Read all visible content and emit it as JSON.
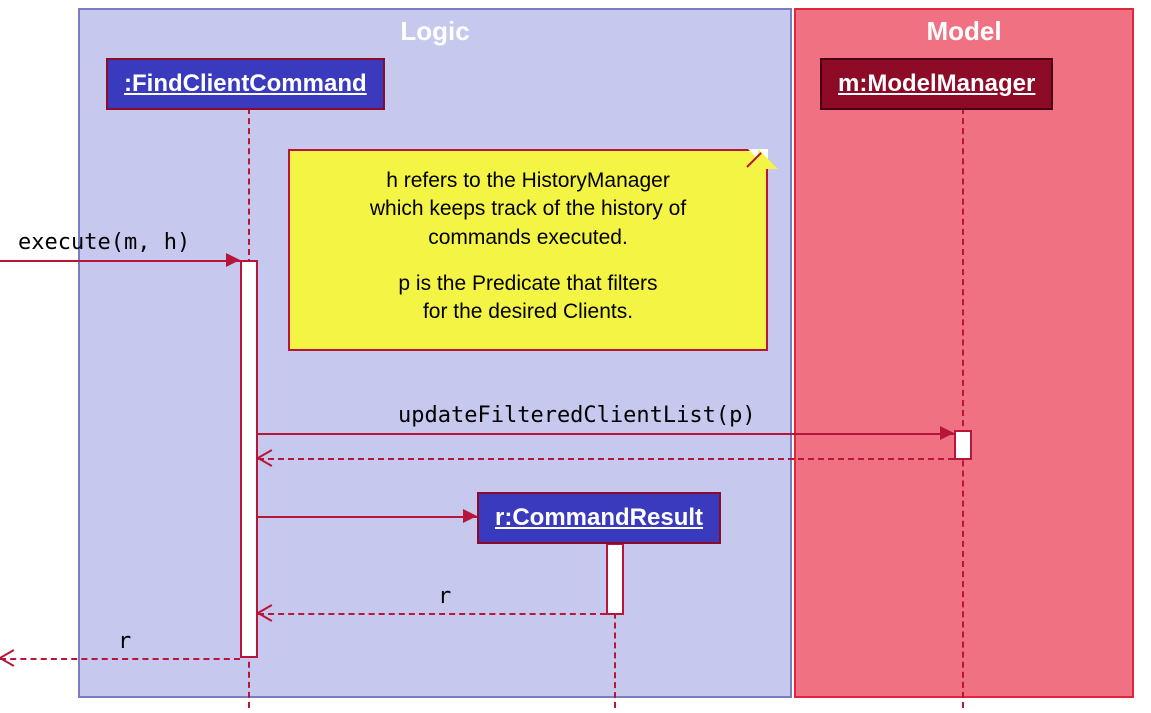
{
  "participants": {
    "logic": {
      "label": "Logic"
    },
    "model": {
      "label": "Model"
    }
  },
  "objects": {
    "findClientCommand": {
      "label": ":FindClientCommand"
    },
    "modelManager": {
      "label": "m:ModelManager"
    },
    "commandResult": {
      "label": "r:CommandResult"
    }
  },
  "note": {
    "line1": "h refers to the HistoryManager",
    "line2": "which keeps track of the history of",
    "line3": "commands executed.",
    "line4": "p is the Predicate that filters",
    "line5": "for the desired Clients."
  },
  "messages": {
    "execute": {
      "label": "execute(m, h)"
    },
    "updateFiltered": {
      "label": "updateFilteredClientList(p)"
    },
    "returnR1": {
      "label": "r"
    },
    "returnR2": {
      "label": "r"
    }
  }
}
